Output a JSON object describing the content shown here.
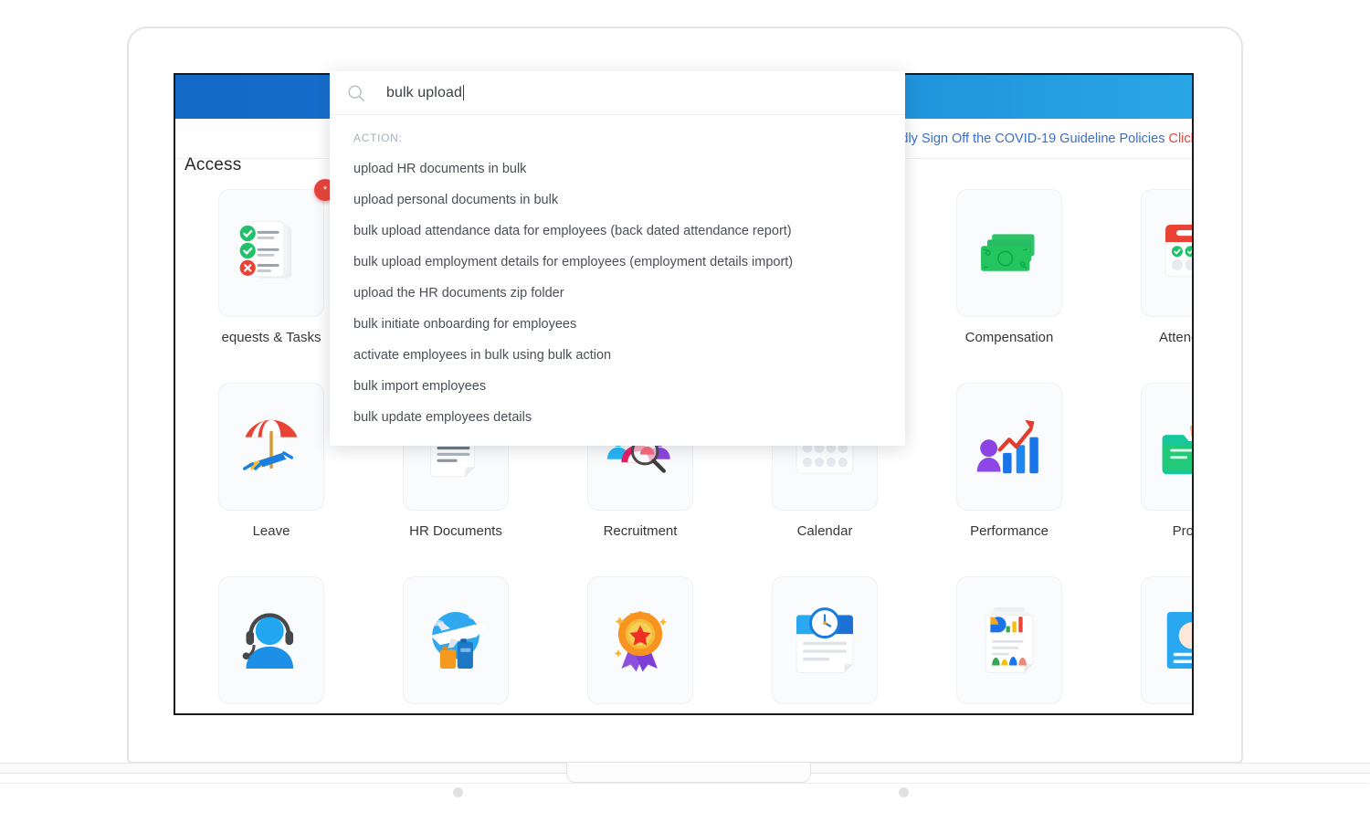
{
  "app": {
    "notice": {
      "text": "dly Sign Off the COVID-19 Guideline Policies ",
      "link_text": "Click h"
    },
    "section_title": "Access"
  },
  "search": {
    "icon": "search-icon",
    "value": "bulk upload",
    "suggestions_header": "ACTION:",
    "suggestions": [
      "upload HR documents in bulk",
      "upload personal documents in bulk",
      "bulk upload attendance data for employees (back dated attendance report)",
      "bulk upload employment details for employees (employment details import)",
      "upload the HR documents zip folder",
      "bulk initiate onboarding for employees",
      "activate employees in bulk using bulk action",
      "bulk import employees",
      "bulk update employees details"
    ]
  },
  "tiles": [
    {
      "label": "equests & Tasks",
      "icon": "requests-tasks-icon",
      "badge": "*"
    },
    {
      "label": "",
      "icon": "hidden-tile-icon",
      "badge": ""
    },
    {
      "label": "",
      "icon": "hidden-tile-icon",
      "badge": ""
    },
    {
      "label": "",
      "icon": "hidden-tile-icon",
      "badge": ""
    },
    {
      "label": "Compensation",
      "icon": "money-icon",
      "badge": ""
    },
    {
      "label": "Attendance",
      "icon": "calendar-clock-icon",
      "badge": ""
    },
    {
      "label": "Leave",
      "icon": "beach-umbrella-icon",
      "badge": ""
    },
    {
      "label": "HR Documents",
      "icon": "document-icon",
      "badge": ""
    },
    {
      "label": "Recruitment",
      "icon": "people-search-icon",
      "badge": ""
    },
    {
      "label": "Calendar",
      "icon": "calendar-icon",
      "badge": ""
    },
    {
      "label": "Performance",
      "icon": "person-chart-icon",
      "badge": ""
    },
    {
      "label": "Project",
      "icon": "folder-icon",
      "badge": ""
    },
    {
      "label": "",
      "icon": "headset-support-icon",
      "badge": ""
    },
    {
      "label": "",
      "icon": "travel-plane-icon",
      "badge": ""
    },
    {
      "label": "",
      "icon": "award-ribbon-icon",
      "badge": ""
    },
    {
      "label": "",
      "icon": "timesheet-clock-icon",
      "badge": ""
    },
    {
      "label": "",
      "icon": "analytics-report-icon",
      "badge": ""
    },
    {
      "label": "",
      "icon": "survey-pencil-icon",
      "badge": ""
    }
  ],
  "colors": {
    "header_blue_start": "#1468c8",
    "header_blue_end": "#29a6e6",
    "notice_blue": "#3b6fc4",
    "notice_red": "#e8453c",
    "badge_red": "#e8453c",
    "text_dark": "#34373b",
    "suggest_gray": "#a8b0ba"
  }
}
